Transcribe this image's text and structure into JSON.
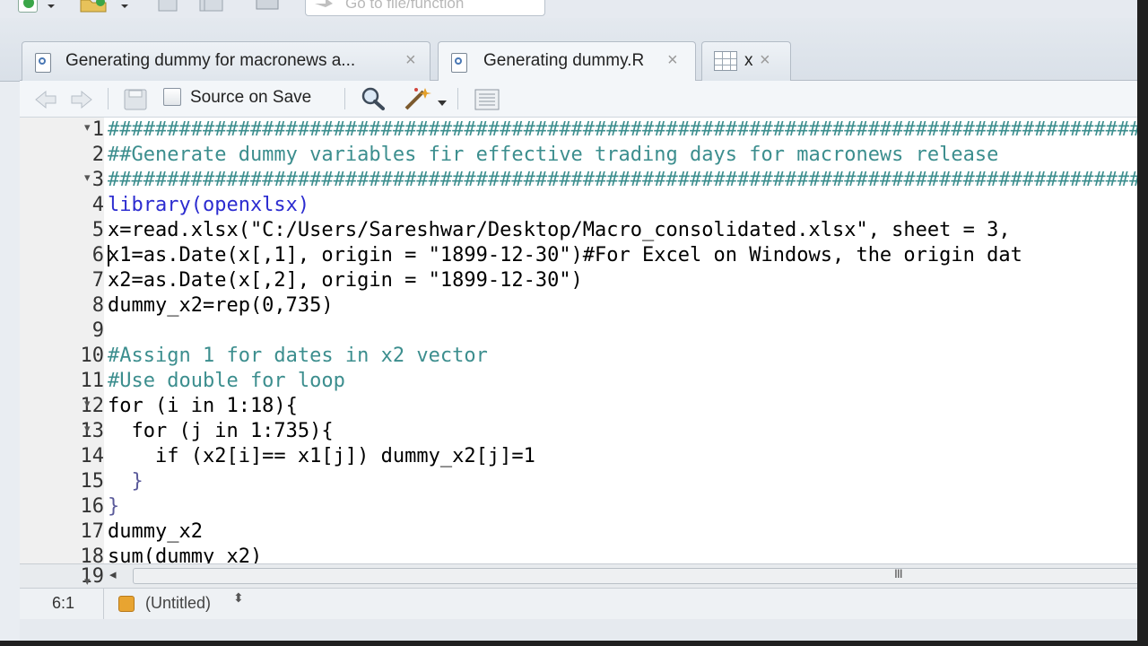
{
  "toolbar": {
    "goto_placeholder": "Go to file/function"
  },
  "tabs": [
    {
      "label": "Generating dummy for macronews a...",
      "close": "×",
      "icon": "r-document-icon"
    },
    {
      "label": "Generating dummy.R",
      "close": "×",
      "icon": "r-document-icon",
      "active": true
    },
    {
      "label": "x",
      "close": "×",
      "icon": "data-grid-icon"
    }
  ],
  "editor_toolbar": {
    "source_on_save": "Source on Save"
  },
  "code_lines": [
    {
      "num": "1",
      "fold": "▾",
      "text": "##########################################################################################"
    },
    {
      "num": "2",
      "fold": "",
      "text": "##Generate dummy variables fir effective trading days for macronews release"
    },
    {
      "num": "3",
      "fold": "▾",
      "text": "##########################################################################################"
    },
    {
      "num": "4",
      "fold": "",
      "text": "library(openxlsx)"
    },
    {
      "num": "5",
      "fold": "",
      "text": "x=read.xlsx(\"C:/Users/Sareshwar/Desktop/Macro_consolidated.xlsx\", sheet = 3,"
    },
    {
      "num": "6",
      "fold": "",
      "text": "x1=as.Date(x[,1], origin = \"1899-12-30\")#For Excel on Windows, the origin dat"
    },
    {
      "num": "7",
      "fold": "",
      "text": "x2=as.Date(x[,2], origin = \"1899-12-30\")"
    },
    {
      "num": "8",
      "fold": "",
      "text": "dummy_x2=rep(0,735)"
    },
    {
      "num": "9",
      "fold": "",
      "text": ""
    },
    {
      "num": "10",
      "fold": "",
      "text": "#Assign 1 for dates in x2 vector"
    },
    {
      "num": "11",
      "fold": "",
      "text": "#Use double for loop"
    },
    {
      "num": "12",
      "fold": "▾",
      "text": "for (i in 1:18){"
    },
    {
      "num": "13",
      "fold": "▾",
      "text": "  for (j in 1:735){"
    },
    {
      "num": "14",
      "fold": "",
      "text": "    if (x2[i]== x1[j]) dummy_x2[j]=1"
    },
    {
      "num": "15",
      "fold": "",
      "text": "  }"
    },
    {
      "num": "16",
      "fold": "",
      "text": "}"
    },
    {
      "num": "17",
      "fold": "",
      "text": "dummy_x2"
    },
    {
      "num": "18",
      "fold": "",
      "text": "sum(dummy_x2)"
    }
  ],
  "line19": {
    "num": "19",
    "fold": "▾"
  },
  "scrollbar": {
    "left_arrow": "◂",
    "grip": "III"
  },
  "status": {
    "position": "6:1",
    "scope": "(Untitled)",
    "updown": "⬍"
  }
}
